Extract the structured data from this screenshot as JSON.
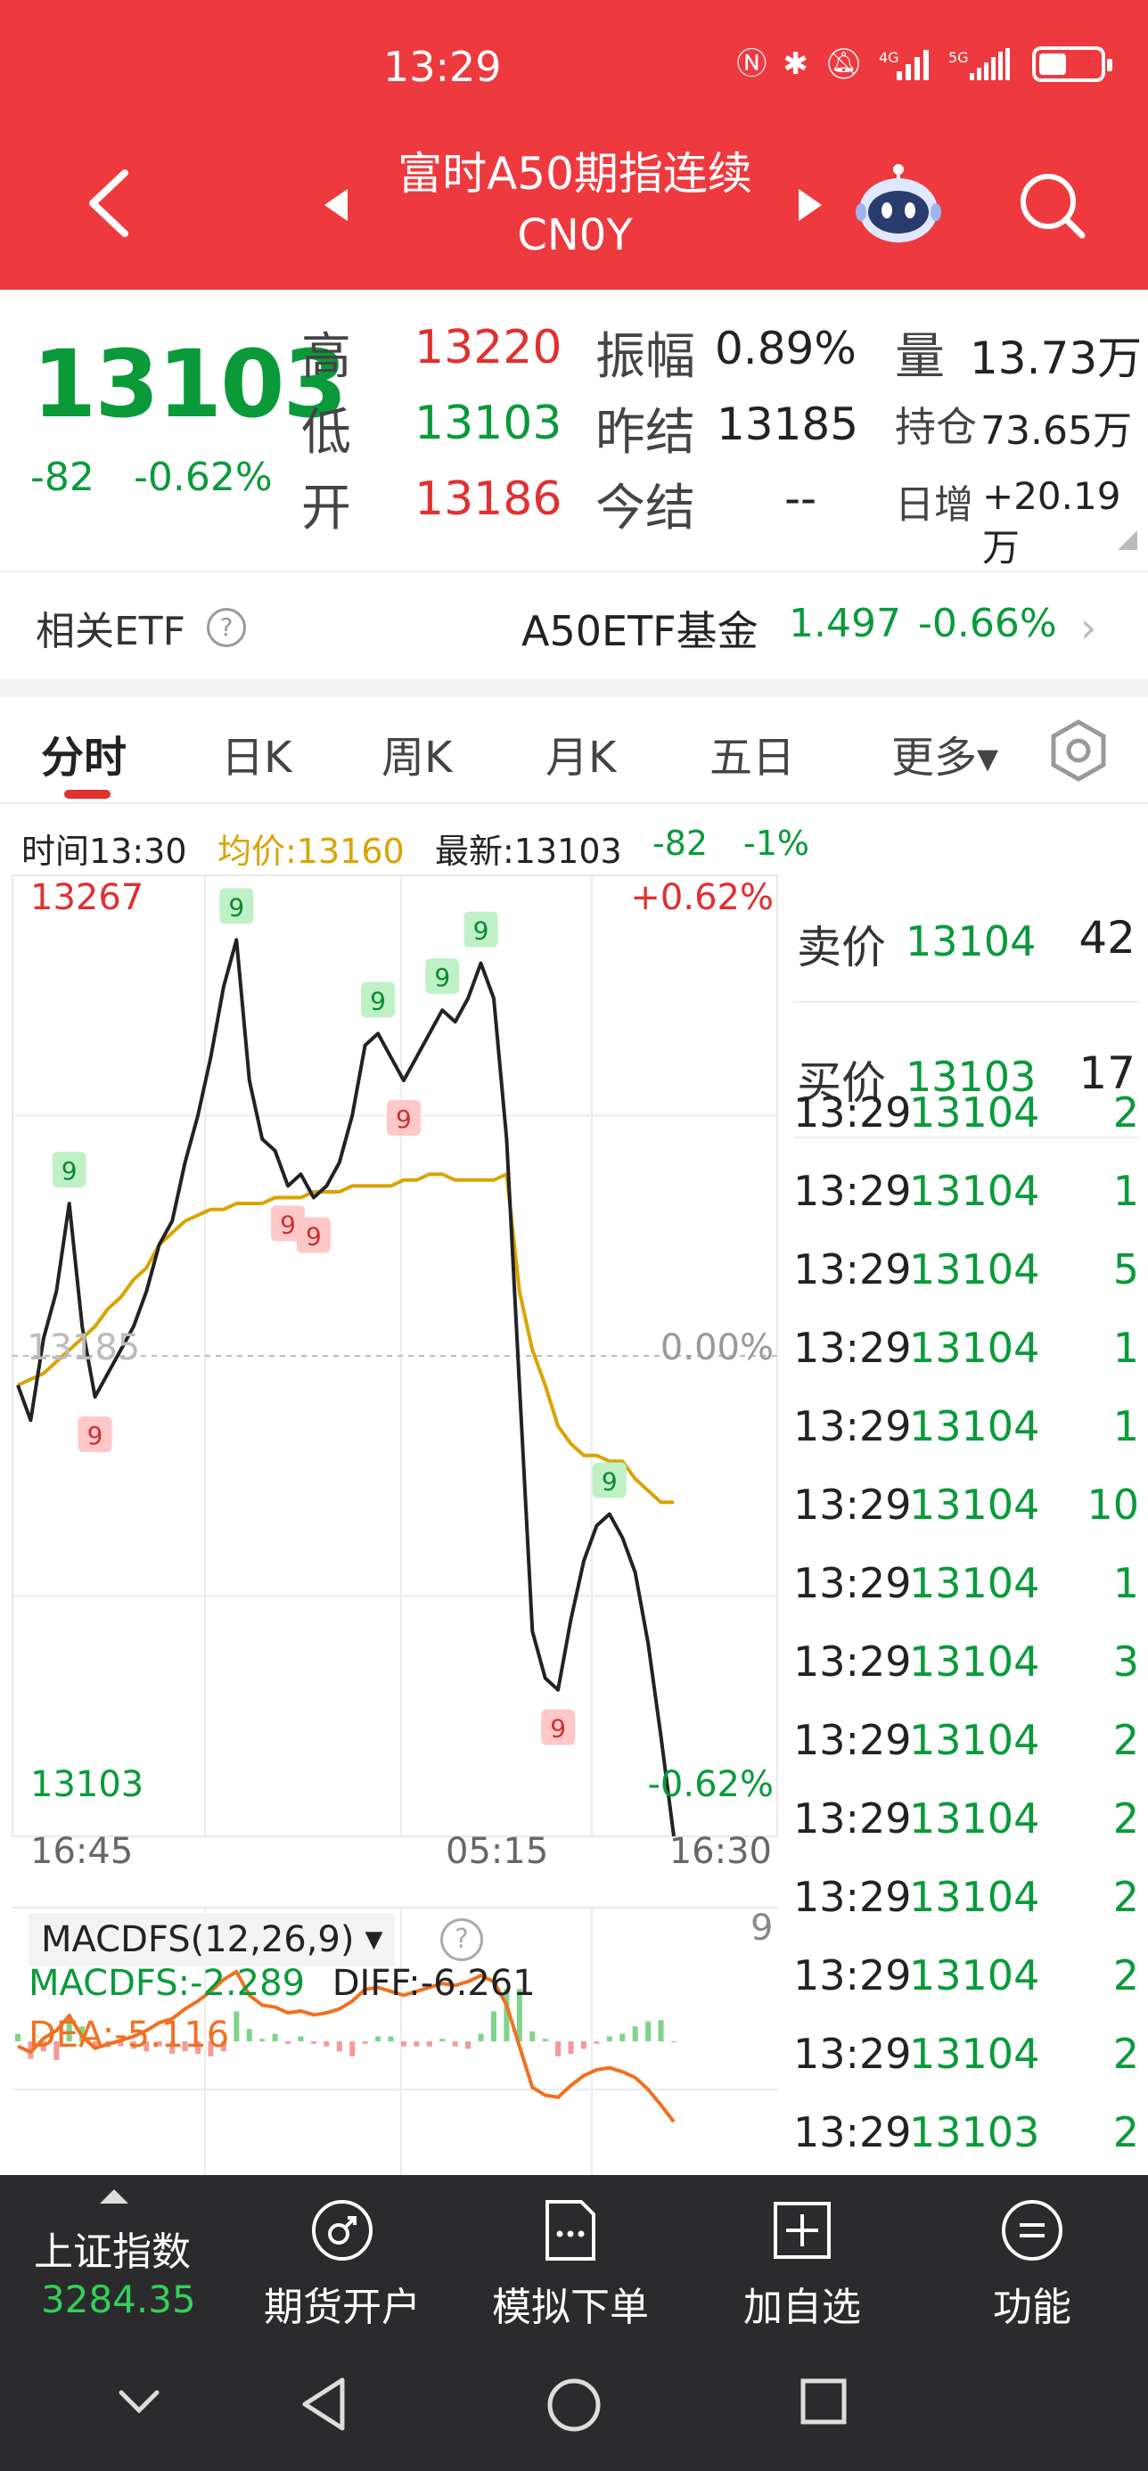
{
  "status": {
    "time": "13:29",
    "battery_level": 0.45
  },
  "header": {
    "title": "富时A50期指连续",
    "code": "CN0Y"
  },
  "quote": {
    "price": "13103",
    "change": "-82",
    "change_pct": "-0.62%",
    "high_label": "高",
    "high": "13220",
    "low_label": "低",
    "low": "13103",
    "open_label": "开",
    "open": "13186",
    "amp_label": "振幅",
    "amp": "0.89%",
    "prev_settle_label": "昨结",
    "prev_settle": "13185",
    "settle_label": "今结",
    "settle": "--",
    "vol_label": "量",
    "vol": "13.73万",
    "oi_label": "持仓",
    "oi": "73.65万",
    "oi_chg_label": "日增",
    "oi_chg": "+20.19万"
  },
  "etf": {
    "label": "相关ETF",
    "help": "?",
    "name": "A50ETF基金",
    "price": "1.497",
    "pct": "-0.66%",
    "chevron": "›"
  },
  "tabs": [
    {
      "label": "分时"
    },
    {
      "label": "日K"
    },
    {
      "label": "周K"
    },
    {
      "label": "月K"
    },
    {
      "label": "五日"
    },
    {
      "label": "更多▾"
    }
  ],
  "info": {
    "time": "时间13:30",
    "avg": "均价:13160",
    "latest": "最新:13103",
    "chg": "-82",
    "pct": "-1%"
  },
  "chart": {
    "y_top": "13267",
    "y_mid": "13185",
    "y_bottom": "13103",
    "pct_top": "+0.62%",
    "pct_mid": "0.00%",
    "pct_bottom": "-0.62%",
    "x_ticks": [
      "16:45",
      "05:15",
      "16:30"
    ],
    "nine_label": "9"
  },
  "chart_data": {
    "type": "line",
    "title": "",
    "x_ticks": [
      "16:45",
      "05:15",
      "16:30"
    ],
    "ylim": [
      13103,
      13267
    ],
    "reference": 13185,
    "series": [
      {
        "name": "",
        "values": [
          13180,
          13174,
          13188,
          13196,
          13211,
          13190,
          13178,
          13182,
          13186,
          13190,
          13196,
          13204,
          13208,
          13218,
          13226,
          13236,
          13248,
          13256,
          13232,
          13222,
          13220,
          13214,
          13216,
          13212,
          13214,
          13218,
          13226,
          13238,
          13240,
          13236,
          13232,
          13236,
          13240,
          13244,
          13242,
          13246,
          13252,
          13246,
          13222,
          13180,
          13138,
          13130,
          13128,
          13140,
          13150,
          13156,
          13158,
          13154,
          13148,
          13136,
          13120,
          13103
        ]
      },
      {
        "name": "",
        "values": [
          13180,
          13181,
          13182,
          13184,
          13186,
          13188,
          13190,
          13193,
          13195,
          13198,
          13200,
          13204,
          13206,
          13208,
          13209,
          13210,
          13210,
          13211,
          13211,
          13211,
          13212,
          13212,
          13212,
          13213,
          13213,
          13213,
          13214,
          13214,
          13214,
          13214,
          13215,
          13215,
          13216,
          13216,
          13215,
          13215,
          13215,
          13215,
          13216,
          13196,
          13186,
          13180,
          13173,
          13170,
          13168,
          13168,
          13167,
          13167,
          13164,
          13162,
          13160,
          13160
        ]
      }
    ]
  },
  "macd": {
    "name": "MACDFS(12,26,9)",
    "help": "?",
    "nine": "9",
    "macdfs": "MACDFS:-2.289",
    "diff": "DIFF:-6.261",
    "dea": "DEA:-5.116"
  },
  "orderbook": {
    "ask_label": "卖价",
    "ask_price": "13104",
    "ask_qty": "42",
    "bid_label": "买价",
    "bid_price": "13103",
    "bid_qty": "17",
    "trades": [
      {
        "t": "13:29",
        "p": "13104",
        "v": "2"
      },
      {
        "t": "13:29",
        "p": "13104",
        "v": "1"
      },
      {
        "t": "13:29",
        "p": "13104",
        "v": "5"
      },
      {
        "t": "13:29",
        "p": "13104",
        "v": "1"
      },
      {
        "t": "13:29",
        "p": "13104",
        "v": "1"
      },
      {
        "t": "13:29",
        "p": "13104",
        "v": "10"
      },
      {
        "t": "13:29",
        "p": "13104",
        "v": "1"
      },
      {
        "t": "13:29",
        "p": "13104",
        "v": "3"
      },
      {
        "t": "13:29",
        "p": "13104",
        "v": "2"
      },
      {
        "t": "13:29",
        "p": "13104",
        "v": "2"
      },
      {
        "t": "13:29",
        "p": "13104",
        "v": "2"
      },
      {
        "t": "13:29",
        "p": "13104",
        "v": "2"
      },
      {
        "t": "13:29",
        "p": "13104",
        "v": "2"
      },
      {
        "t": "13:29",
        "p": "13103",
        "v": "2"
      }
    ]
  },
  "bottom": {
    "index_name": "上证指数",
    "index_value": "3284.35",
    "items": [
      {
        "label": "期货开户"
      },
      {
        "label": "模拟下单"
      },
      {
        "label": "加自选"
      },
      {
        "label": "功能"
      }
    ]
  },
  "colors": {
    "header": "#ee3a3f",
    "up": "#e03030",
    "down": "#0a9a3a",
    "avg_line": "#d9a300",
    "macd_line": "#f07020"
  }
}
